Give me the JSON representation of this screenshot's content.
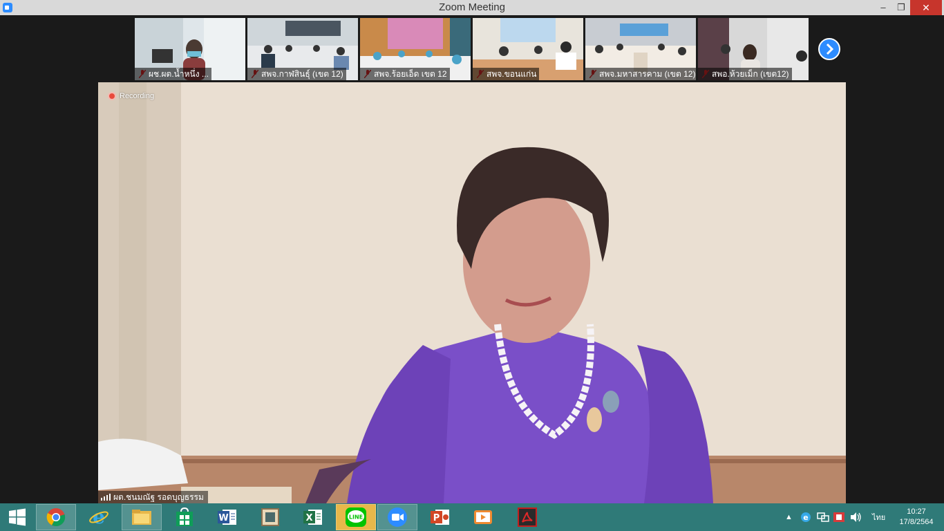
{
  "window": {
    "title": "Zoom Meeting",
    "min": "–",
    "max": "❐",
    "close": "✕"
  },
  "recording": {
    "label": "Recording"
  },
  "participants": [
    {
      "name": "ผช.ผต.น้ำหนึ่ง ..."
    },
    {
      "name": "สพจ.กาฬสินธุ์ (เขต 12)"
    },
    {
      "name": "สพจ.ร้อยเอ็ด เขต 12"
    },
    {
      "name": "สพจ.ขอนแก่น"
    },
    {
      "name": "สพจ.มหาสารคาม (เขต 12)"
    },
    {
      "name": "สพอ.ห้วยเม็ก (เขต12)"
    }
  ],
  "next_icon": "chevron-right-icon",
  "speaker": {
    "name": "ผต.ชนมณัฐ รอดบุญธรรม"
  },
  "taskbar": {
    "apps": [
      {
        "name": "start"
      },
      {
        "name": "chrome"
      },
      {
        "name": "internet-explorer"
      },
      {
        "name": "file-explorer"
      },
      {
        "name": "store"
      },
      {
        "name": "word",
        "label": "W"
      },
      {
        "name": "app-window"
      },
      {
        "name": "excel",
        "label": "X"
      },
      {
        "name": "line",
        "label": "LINE"
      },
      {
        "name": "zoom"
      },
      {
        "name": "powerpoint",
        "label": "P"
      },
      {
        "name": "video-player"
      },
      {
        "name": "acrobat"
      }
    ],
    "tray": {
      "chevron": "▲",
      "lang": "ไทย",
      "time": "10:27",
      "date": "17/8/2564"
    }
  },
  "colors": {
    "accent": "#2d8cff",
    "taskbar": "#2f7a78",
    "close": "#c7352c"
  }
}
